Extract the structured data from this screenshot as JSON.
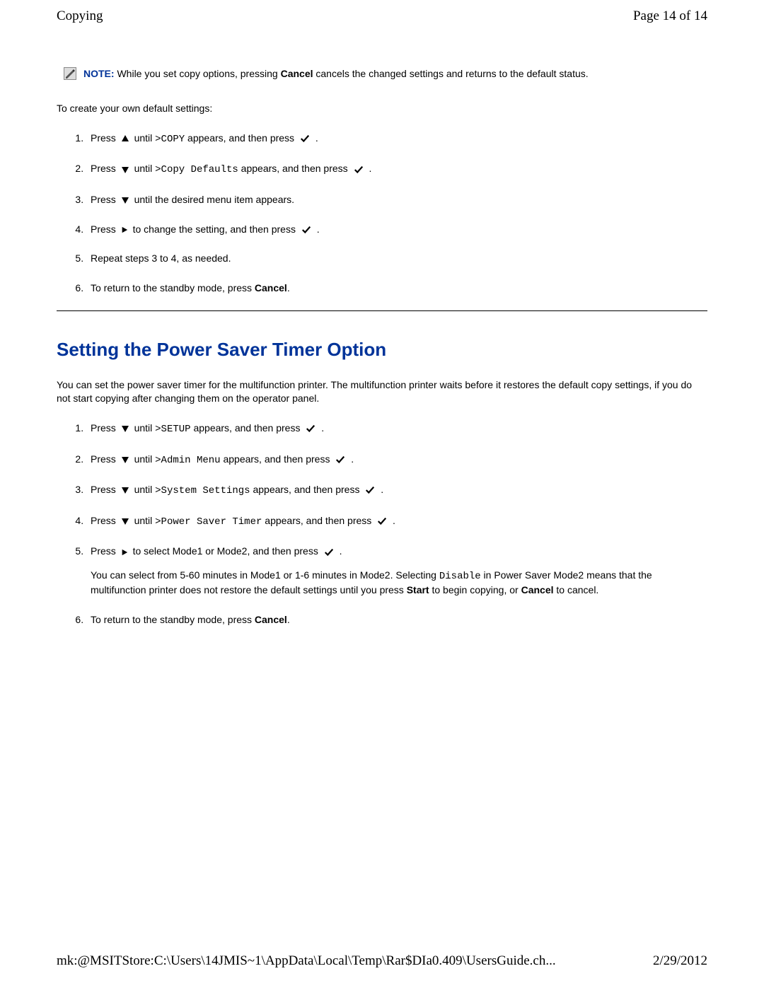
{
  "header": {
    "title": "Copying",
    "page": "Page 14 of 14"
  },
  "note": {
    "label": "NOTE:",
    "pre": " While you set copy options, pressing ",
    "bold1": "Cancel",
    "post": " cancels the changed settings and returns to the default status."
  },
  "intro1": "To create your own default settings:",
  "list1": {
    "s1a": "Press ",
    "s1b": " until ",
    "s1c": ">COPY",
    "s1d": " appears, and then press ",
    "s1e": " .",
    "s2a": "Press ",
    "s2b": " until ",
    "s2c": ">Copy Defaults",
    "s2d": " appears, and then press ",
    "s2e": " .",
    "s3a": "Press ",
    "s3b": " until the desired menu item appears.",
    "s4a": "Press ",
    "s4b": " to change the setting, and then press ",
    "s4c": " .",
    "s5": "Repeat steps 3 to 4, as needed.",
    "s6a": "To return to the standby mode, press ",
    "s6b": "Cancel",
    "s6c": "."
  },
  "heading": "Setting the Power Saver Timer Option",
  "para2": "You can set the power saver timer for the multifunction printer. The multifunction printer waits before it restores the default copy settings, if you do not start copying after changing them on the operator panel.",
  "list2": {
    "s1a": "Press ",
    "s1b": " until ",
    "s1c": ">SETUP",
    "s1d": " appears, and then press ",
    "s1e": " .",
    "s2a": "Press ",
    "s2b": " until ",
    "s2c": ">Admin Menu",
    "s2d": " appears, and then press ",
    "s2e": " .",
    "s3a": "Press ",
    "s3b": " until ",
    "s3c": ">System Settings",
    "s3d": " appears, and then press ",
    "s3e": " .",
    "s4a": "Press ",
    "s4b": " until ",
    "s4c": ">Power Saver Timer",
    "s4d": " appears, and then press ",
    "s4e": " .",
    "s5a": "Press ",
    "s5b": " to select Mode1 or Mode2, and then press ",
    "s5c": " .",
    "s5para_a": "You can select from 5-60 minutes in Mode1 or 1-6 minutes in Mode2. Selecting ",
    "s5para_b": "Disable",
    "s5para_c": " in Power Saver Mode2 means that the multifunction printer does not restore the default settings until you press ",
    "s5para_d": "Start",
    "s5para_e": " to begin copying, or ",
    "s5para_f": "Cancel",
    "s5para_g": " to cancel.",
    "s6a": "To return to the standby mode, press ",
    "s6b": "Cancel",
    "s6c": "."
  },
  "footer": {
    "path": "mk:@MSITStore:C:\\Users\\14JMIS~1\\AppData\\Local\\Temp\\Rar$DIa0.409\\UsersGuide.ch...",
    "date": "2/29/2012"
  }
}
